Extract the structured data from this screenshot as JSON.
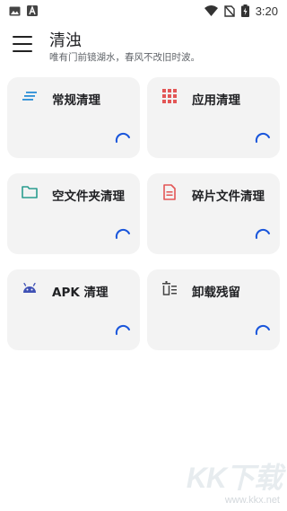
{
  "status_bar": {
    "time": "3:20",
    "icons": [
      "gallery-icon",
      "a-notification-icon",
      "wifi-icon",
      "no-sim-icon",
      "battery-charging-icon"
    ]
  },
  "header": {
    "menu_icon": "menu-icon",
    "title": "清浊",
    "subtitle": "唯有门前镜湖水，春风不改旧时波。"
  },
  "cards": [
    {
      "label": "常规清理",
      "icon": "lines-icon",
      "icon_color": "#2b8fd6"
    },
    {
      "label": "应用清理",
      "icon": "grid-icon",
      "icon_color": "#e35656"
    },
    {
      "label": "空文件夹清理",
      "icon": "folder-icon",
      "icon_color": "#2a9d8f"
    },
    {
      "label": "碎片文件清理",
      "icon": "document-icon",
      "icon_color": "#e35656"
    },
    {
      "label": "APK 清理",
      "icon": "android-icon",
      "icon_color": "#3f51b5"
    },
    {
      "label": "卸载残留",
      "icon": "trash-list-icon",
      "icon_color": "#444444"
    }
  ],
  "spinner_color": "#1a56db",
  "watermark": {
    "text": "KK下载",
    "url": "www.kkx.net"
  }
}
